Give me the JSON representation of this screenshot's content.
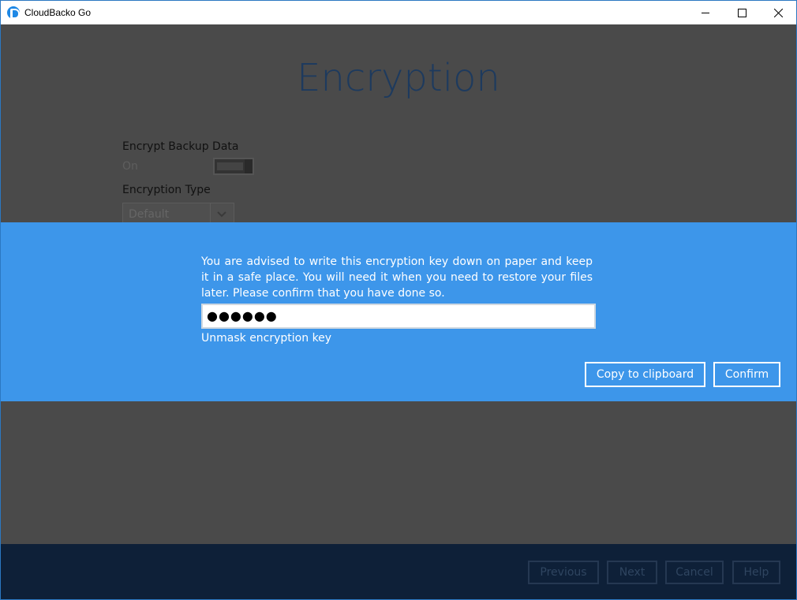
{
  "window": {
    "title": "CloudBacko Go"
  },
  "page": {
    "title": "Encryption",
    "encrypt_label": "Encrypt Backup Data",
    "encrypt_state": "On",
    "type_label": "Encryption Type",
    "type_value": "Default"
  },
  "dialog": {
    "message": "You are advised to write this encryption key down on paper and keep it in a safe place. You will need it when you need to restore your files later. Please confirm that you have done so.",
    "key_masked": "●●●●●●",
    "unmask_label": "Unmask encryption key",
    "copy_label": "Copy to clipboard",
    "confirm_label": "Confirm"
  },
  "footer": {
    "previous_label": "Previous",
    "next_label": "Next",
    "cancel_label": "Cancel",
    "help_label": "Help"
  },
  "colors": {
    "dialog_bg": "#3d96ea",
    "overlay_bg": "#4a4a4a",
    "footer_bg": "#0e2038",
    "title_color": "#1d3a5e"
  }
}
